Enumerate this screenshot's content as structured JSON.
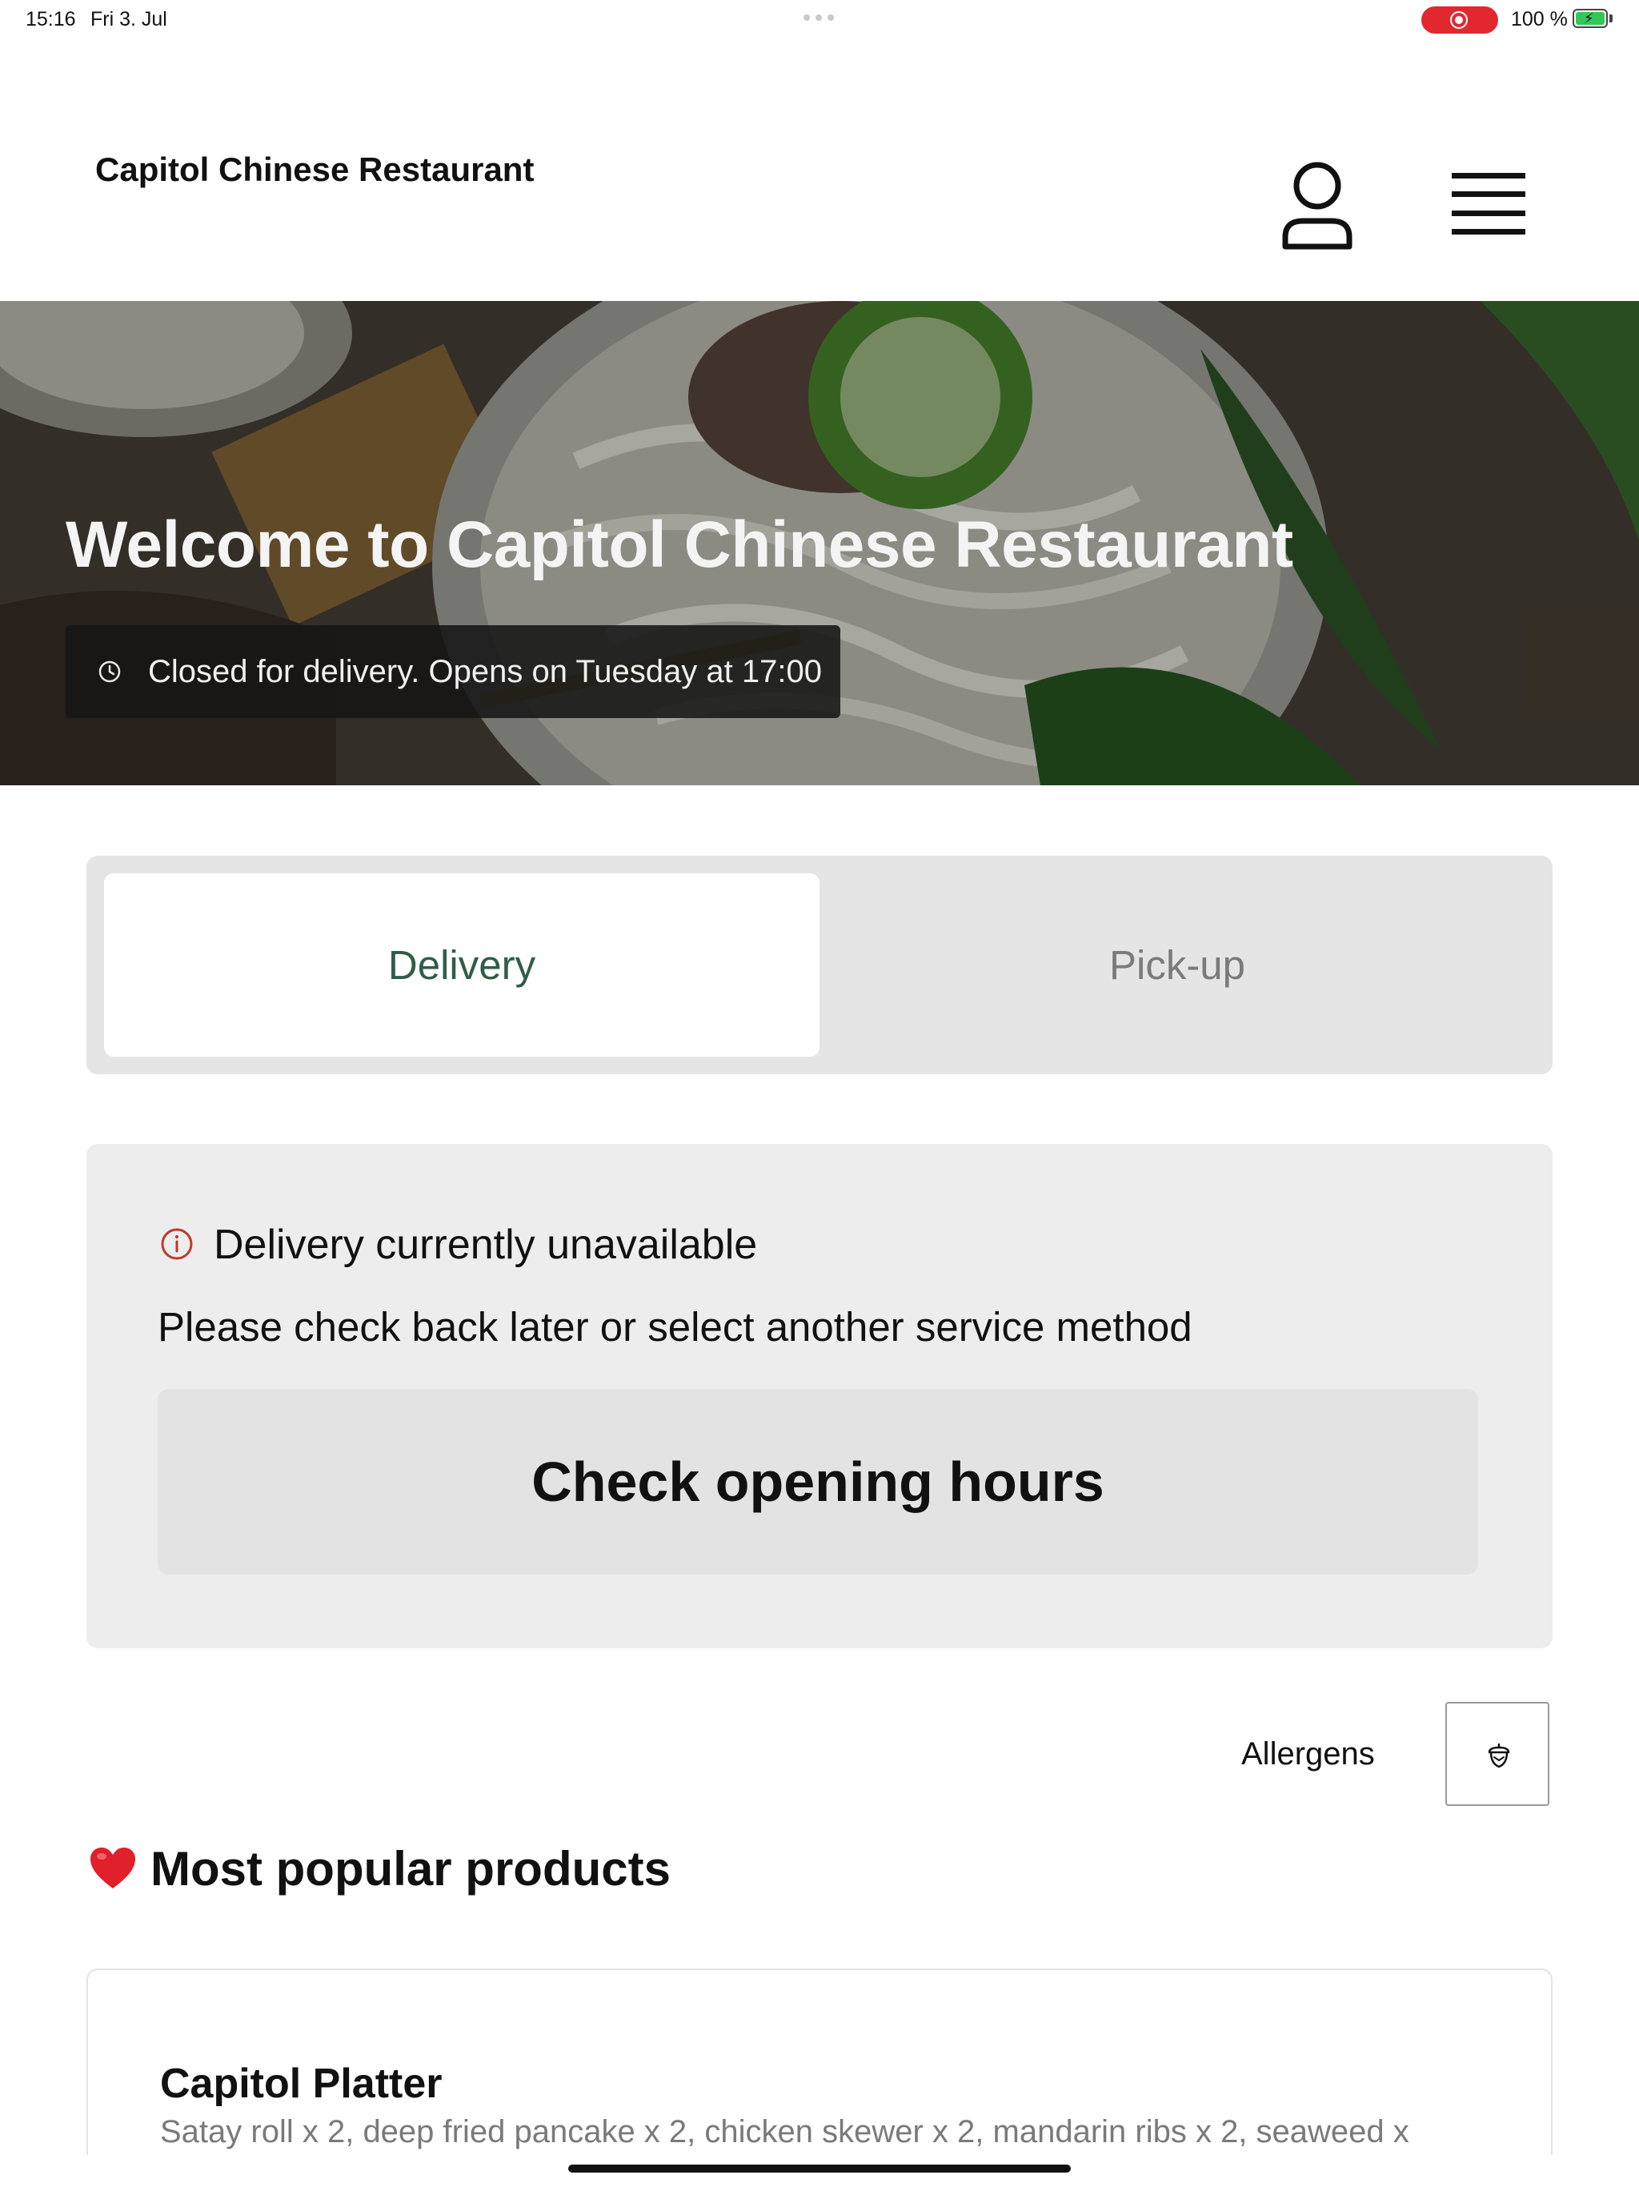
{
  "status_bar": {
    "time": "15:16",
    "date": "Fri 3. Jul",
    "battery": "100 %",
    "recording_color": "#e2282f",
    "battery_color": "#32c759"
  },
  "header": {
    "brand": "Capitol Chinese Restaurant",
    "account_icon": "user-icon",
    "menu_icon": "hamburger-menu-icon"
  },
  "hero": {
    "title": "Welcome to Capitol Chinese Restaurant",
    "status": "Closed for delivery. Opens on Tuesday at 17:00",
    "status_icon": "clock-icon"
  },
  "service_toggle": {
    "selected": "Delivery",
    "delivery_label": "Delivery",
    "pickup_label": "Pick-up",
    "accent_color": "#2f5e46"
  },
  "unavailable": {
    "icon": "info-icon",
    "title": "Delivery currently unavailable",
    "message": "Please check back later or select another service method",
    "button_label": "Check opening hours",
    "icon_color": "#c0392b"
  },
  "allergens": {
    "label": "Allergens",
    "icon": "acorn-icon"
  },
  "popular": {
    "emoji_icon": "heart-icon",
    "title": "Most popular products",
    "products": [
      {
        "name": "Capitol Platter",
        "description": "Satay roll x 2, deep fried pancake x 2, chicken skewer x 2, mandarin ribs x 2, seaweed x"
      }
    ]
  }
}
